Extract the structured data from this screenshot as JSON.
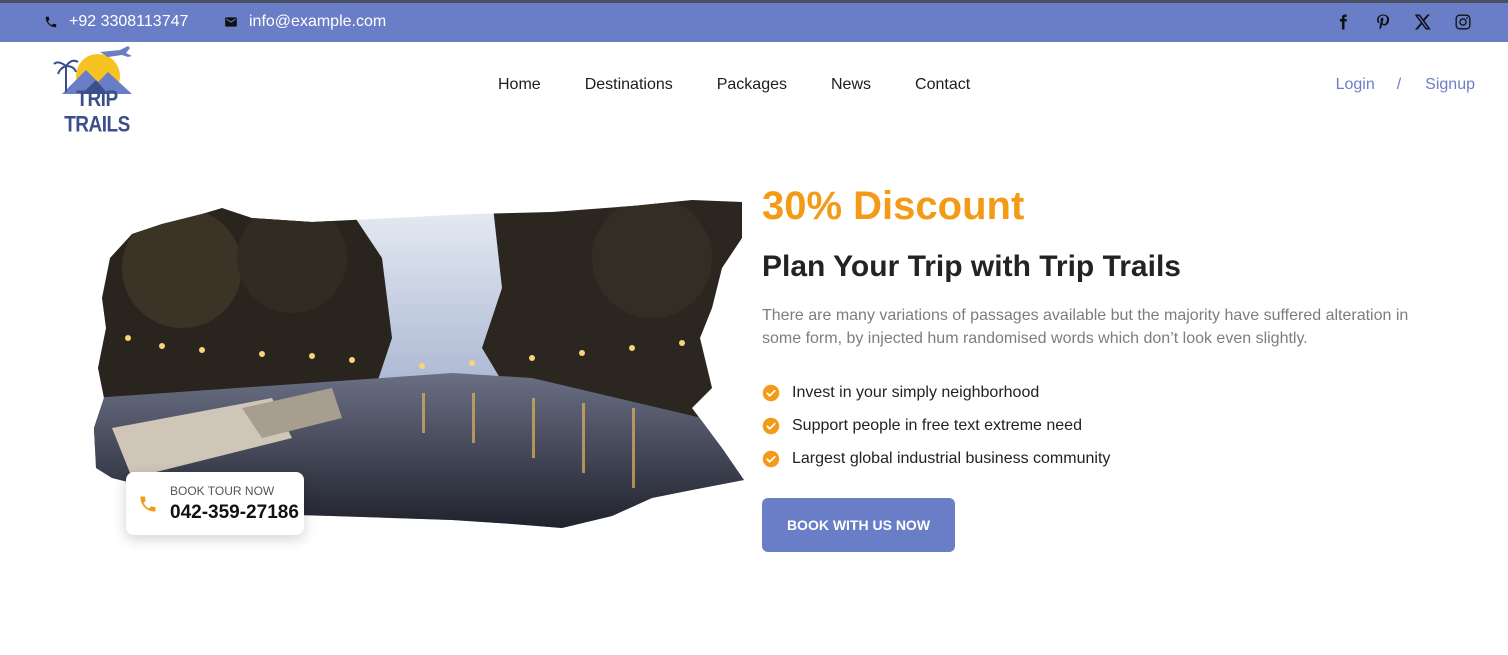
{
  "topbar": {
    "phone": "+92 3308113747",
    "email": "info@example.com",
    "social": [
      "facebook-icon",
      "pinterest-icon",
      "x-icon",
      "instagram-icon"
    ]
  },
  "brand": {
    "name": "TRIP TRAILS"
  },
  "nav": {
    "items": [
      {
        "label": "Home"
      },
      {
        "label": "Destinations"
      },
      {
        "label": "Packages"
      },
      {
        "label": "News"
      },
      {
        "label": "Contact"
      }
    ],
    "login": "Login",
    "separator": "/",
    "signup": "Signup"
  },
  "hero": {
    "card": {
      "label": "BOOK TOUR NOW",
      "phone": "042-359-27186"
    },
    "discount": "30% Discount",
    "title": "Plan Your Trip with Trip Trails",
    "description": "There are many variations of passages available but the majority have suffered alteration in some form, by injected hum randomised words which don’t look even slightly.",
    "features": [
      "Invest in your simply neighborhood",
      "Support people in free text extreme need",
      "Largest global industrial business community"
    ],
    "cta": "BOOK WITH US NOW"
  },
  "colors": {
    "primary": "#6a7ec8",
    "accent": "#f39b16",
    "text": "#232323",
    "muted": "#7d7d7d"
  }
}
